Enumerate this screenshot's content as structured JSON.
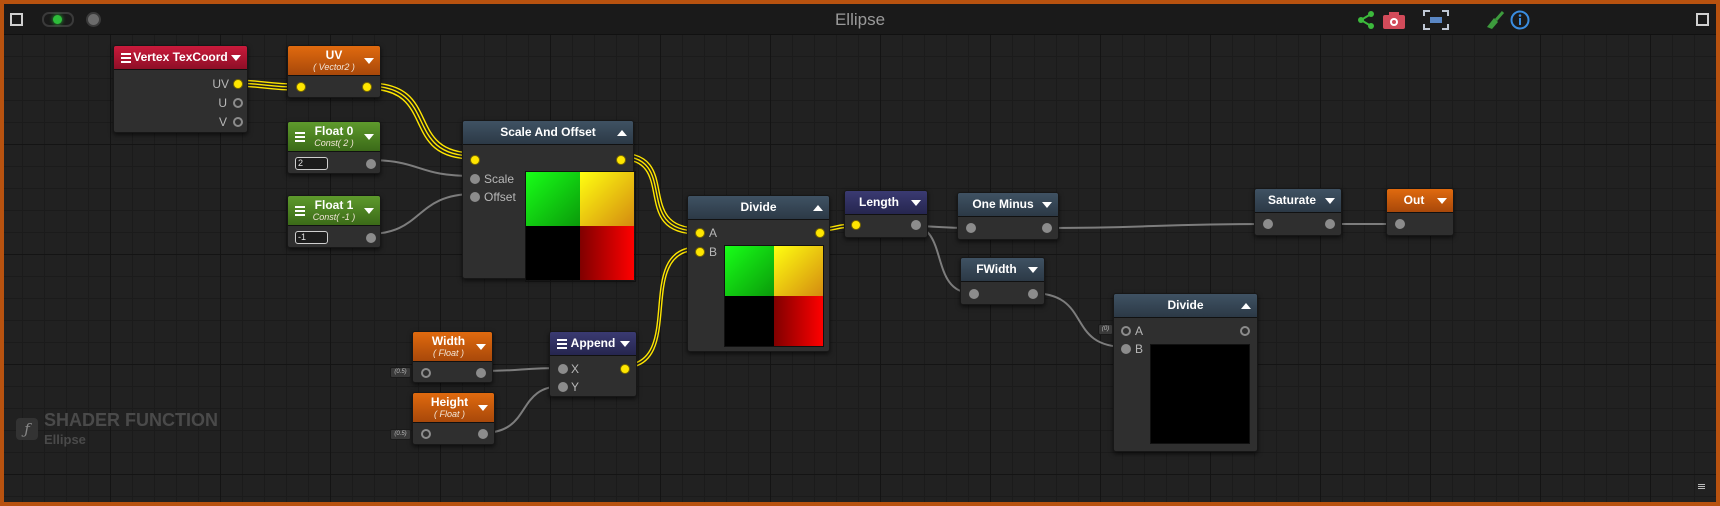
{
  "title": "Ellipse",
  "toolbar": {
    "left_icons": [
      "maximize-icon",
      "live-preview-icon",
      "record-dot-icon"
    ],
    "right_icons": [
      "share-icon",
      "camera-icon",
      "focus-icon",
      "clean-icon",
      "info-icon",
      "maximize-icon"
    ]
  },
  "nodes": {
    "vertex_texcoord": {
      "title": "Vertex TexCoord",
      "outputs": [
        "UV",
        "U",
        "V"
      ]
    },
    "uv": {
      "title": "UV",
      "subtitle": "( Vector2 )"
    },
    "float0": {
      "title": "Float 0",
      "subtitle": "Const( 2 )",
      "value": "2"
    },
    "float1": {
      "title": "Float 1",
      "subtitle": "Const( -1 )",
      "value": "-1"
    },
    "scale_offset": {
      "title": "Scale And Offset",
      "inputs": [
        "Scale",
        "Offset"
      ]
    },
    "divide1": {
      "title": "Divide",
      "inputs": [
        "A",
        "B"
      ]
    },
    "length": {
      "title": "Length"
    },
    "one_minus": {
      "title": "One Minus"
    },
    "saturate": {
      "title": "Saturate"
    },
    "out": {
      "title": "Out"
    },
    "fwidth": {
      "title": "FWidth"
    },
    "divide2": {
      "title": "Divide",
      "inputs": [
        "A",
        "B"
      ],
      "a_default": "(0)"
    },
    "width": {
      "title": "Width",
      "subtitle": "( Float )",
      "default": "(0.5)"
    },
    "height": {
      "title": "Height",
      "subtitle": "( Float )",
      "default": "(0.5)"
    },
    "append": {
      "title": "Append",
      "inputs": [
        "X",
        "Y"
      ]
    }
  },
  "footer": {
    "label": "SHADER FUNCTION",
    "name": "Ellipse"
  },
  "colors": {
    "frame": "#b8520f",
    "canvas": "#212121",
    "wire_active": "#ffe600",
    "wire_inactive": "#7d7d7d",
    "header_orange": "#d8650e",
    "header_red": "#c91a3b",
    "header_green": "#5e9a2c",
    "header_slate": "#3f5263",
    "header_purple": "#3a3a72"
  }
}
